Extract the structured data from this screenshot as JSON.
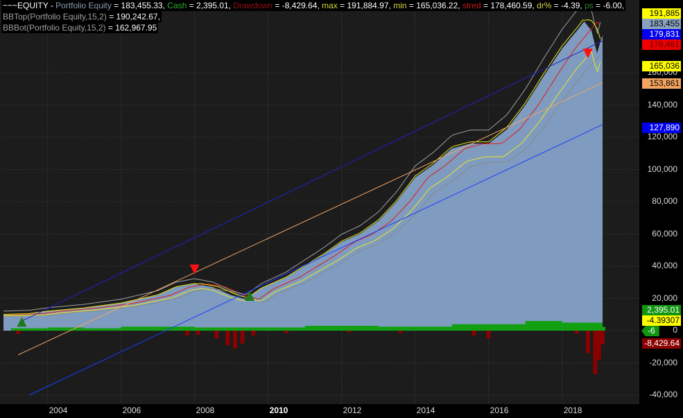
{
  "header": {
    "symbol": "~~~EQUITY - ",
    "pe_label": "Portfolio Equity",
    "pe_val": " = 183,455.33, ",
    "cash_label": "Cash",
    "cash_val": " = 2,395.01, ",
    "dd_label": "Drawdown",
    "dd_val": " = -8,429.64, ",
    "max_label": "max",
    "max_val": " = 191,884.97, ",
    "min_label": "min",
    "min_val": " = 165,036.22, ",
    "stred_label": "stred",
    "stred_val": " = 178,460.59, ",
    "dr_label": "dr%",
    "dr_val": " = -4.39, ",
    "ps_label": "ps",
    "ps_val": " = -6.00,",
    "bbtop_label": "BBTop(Portfolio Equity,15,2)",
    "bbtop_val": " = 190,242.67,",
    "bbbot_label": "BBBot(Portfolio Equity,15,2)",
    "bbbot_val": " = 162,967.95"
  },
  "value_labels": [
    {
      "text": "191,885",
      "value": 191885,
      "bg": "#ffff00",
      "fg": "#000"
    },
    {
      "text": "183,455",
      "value": 183455,
      "bg": "#8aa2c0",
      "fg": "#000"
    },
    {
      "text": "179,831",
      "value": 179831,
      "bg": "#0000ee",
      "fg": "#fff"
    },
    {
      "text": "178,461",
      "value": 178461,
      "bg": "#ee0000",
      "fg": "#600"
    },
    {
      "text": "165,036",
      "value": 165036,
      "bg": "#ffff00",
      "fg": "#000"
    },
    {
      "text": "153,861",
      "value": 153861,
      "bg": "#f4a460",
      "fg": "#000"
    },
    {
      "text": "127,890",
      "value": 127890,
      "bg": "#0000ee",
      "fg": "#fff"
    },
    {
      "text": "2,395.01",
      "value": 2395,
      "bg": "#129612",
      "fg": "#fff"
    },
    {
      "text": "-4.39307",
      "value": -4393,
      "bg": "#ffff00",
      "fg": "#000"
    },
    {
      "text": "-8,429.64",
      "value": -8430,
      "bg": "#8b0000",
      "fg": "#fff"
    }
  ],
  "ps_marker": "-6",
  "chart_data": {
    "type": "area",
    "y_ticks": [
      {
        "v": 160000,
        "t": "160,000"
      },
      {
        "v": 140000,
        "t": "140,000"
      },
      {
        "v": 120000,
        "t": "120,000"
      },
      {
        "v": 100000,
        "t": "100,000"
      },
      {
        "v": 80000,
        "t": "80,000"
      },
      {
        "v": 60000,
        "t": "60,000"
      },
      {
        "v": 40000,
        "t": "40,000"
      },
      {
        "v": 20000,
        "t": "20,000"
      },
      {
        "v": 0,
        "t": "0"
      },
      {
        "v": -20000,
        "t": "-20,000"
      },
      {
        "v": -40000,
        "t": "-40,000"
      }
    ],
    "ylim": [
      -47000,
      205000
    ],
    "x_ticks": [
      "2004",
      "2006",
      "2008",
      "2010",
      "2012",
      "2014",
      "2016",
      "2018"
    ],
    "xlim": [
      2002.8,
      2020.1
    ],
    "equity": [
      [
        2002.8,
        10000
      ],
      [
        2003.5,
        10500
      ],
      [
        2004,
        12000
      ],
      [
        2005,
        14000
      ],
      [
        2006,
        17000
      ],
      [
        2007,
        22000
      ],
      [
        2007.5,
        27000
      ],
      [
        2008,
        29000
      ],
      [
        2008.5,
        27000
      ],
      [
        2009,
        22000
      ],
      [
        2009.4,
        19500
      ],
      [
        2009.8,
        26000
      ],
      [
        2010,
        28000
      ],
      [
        2010.5,
        33000
      ],
      [
        2011,
        40000
      ],
      [
        2011.5,
        47000
      ],
      [
        2012,
        55000
      ],
      [
        2012.5,
        60000
      ],
      [
        2013,
        68000
      ],
      [
        2013.5,
        80000
      ],
      [
        2014,
        95000
      ],
      [
        2014.5,
        103000
      ],
      [
        2015,
        113000
      ],
      [
        2015.5,
        116000
      ],
      [
        2016,
        116000
      ],
      [
        2016.5,
        125000
      ],
      [
        2017,
        140000
      ],
      [
        2017.5,
        158000
      ],
      [
        2018,
        175000
      ],
      [
        2018.4,
        186000
      ],
      [
        2018.6,
        191885
      ],
      [
        2018.8,
        186000
      ],
      [
        2018.95,
        172000
      ],
      [
        2019.05,
        180000
      ],
      [
        2019.1,
        183455
      ]
    ],
    "drawdown": [
      [
        2003.2,
        -2000
      ],
      [
        2007.8,
        -3000
      ],
      [
        2008.1,
        -2500
      ],
      [
        2008.6,
        -5000
      ],
      [
        2008.9,
        -9000
      ],
      [
        2009.1,
        -11000
      ],
      [
        2009.3,
        -8000
      ],
      [
        2009.6,
        -3000
      ],
      [
        2010.5,
        -1500
      ],
      [
        2012.2,
        -1000
      ],
      [
        2013.6,
        -1500
      ],
      [
        2015.6,
        -3000
      ],
      [
        2016,
        -5000
      ],
      [
        2018.4,
        -2000
      ],
      [
        2018.7,
        -14000
      ],
      [
        2018.9,
        -27000
      ],
      [
        2019.0,
        -18000
      ],
      [
        2019.1,
        -8430
      ]
    ],
    "cash": [
      [
        2003,
        1500
      ],
      [
        2004,
        2000
      ],
      [
        2005,
        1500
      ],
      [
        2006,
        2500
      ],
      [
        2008,
        2000
      ],
      [
        2011,
        3000
      ],
      [
        2013,
        2500
      ],
      [
        2015,
        4000
      ],
      [
        2017,
        6000
      ],
      [
        2018,
        5000
      ],
      [
        2019.1,
        2395
      ]
    ],
    "lines": [
      {
        "name": "upper-regression",
        "color": "#2020c8",
        "from": [
          2003.3,
          6000
        ],
        "to": [
          2019.1,
          179831
        ]
      },
      {
        "name": "lower-regression",
        "color": "#1a3cff",
        "from": [
          2003.5,
          -40000
        ],
        "to": [
          2019.1,
          127890
        ]
      },
      {
        "name": "orange-trend",
        "color": "#f4a460",
        "from": [
          2003.2,
          -15000
        ],
        "to": [
          2019.1,
          153861
        ]
      }
    ],
    "signals": [
      {
        "type": "buy",
        "x": 2003.3,
        "y": 5500
      },
      {
        "type": "sell",
        "x": 2008.0,
        "y": 38000
      },
      {
        "type": "buy",
        "x": 2009.5,
        "y": 21500
      },
      {
        "type": "sell",
        "x": 2018.7,
        "y": 172000
      }
    ]
  }
}
